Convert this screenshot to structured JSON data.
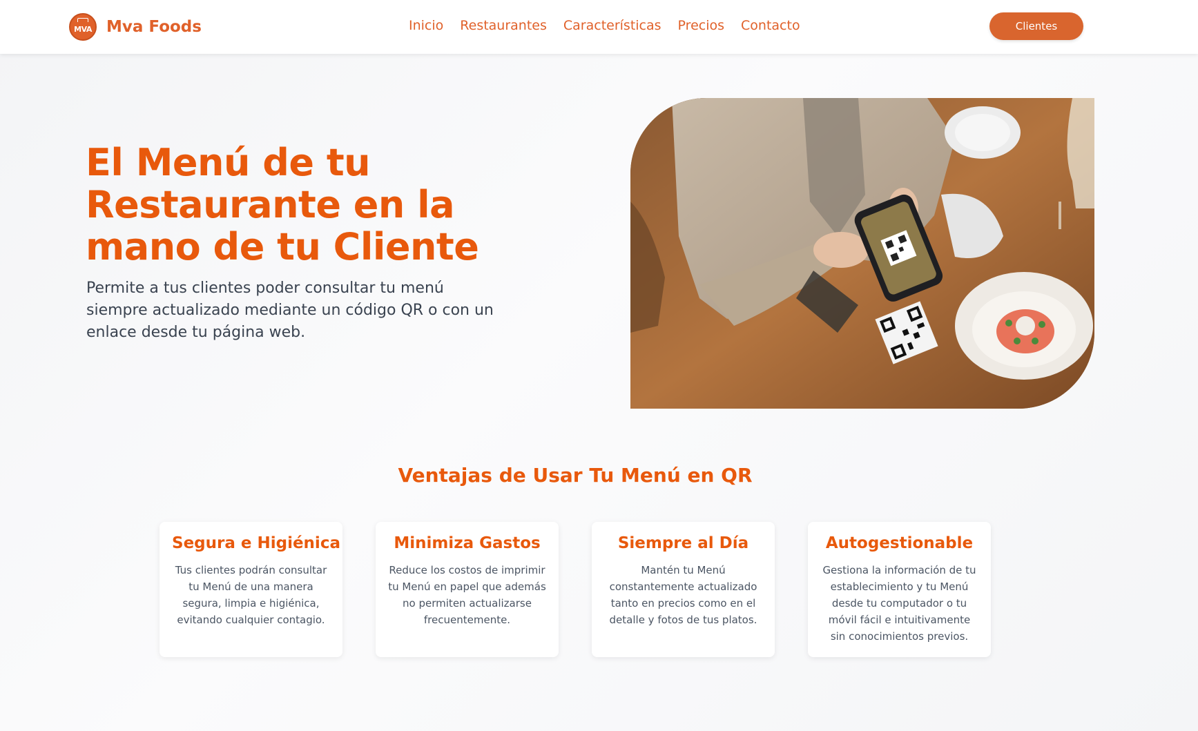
{
  "brand": {
    "logo_text": "MVA",
    "name": "Mva Foods",
    "accent_color": "#e0612a"
  },
  "nav": {
    "links": [
      {
        "label": "Inicio"
      },
      {
        "label": "Restaurantes"
      },
      {
        "label": "Características"
      },
      {
        "label": "Precios"
      },
      {
        "label": "Contacto"
      }
    ],
    "clients_button": "Clientes"
  },
  "hero": {
    "title": "El Menú de tu Restaurante en la mano de tu Cliente",
    "subtitle": "Permite a tus clientes poder consultar tu menú siempre actualizado mediante un código QR o con un enlace desde tu página web."
  },
  "advantages": {
    "title": "Ventajas de Usar Tu Menú en QR",
    "cards": [
      {
        "title": "Segura e Higiénica",
        "text": "Tus clientes podrán consultar tu Menú de una manera segura, limpia e higiénica, evitando cualquier contagio."
      },
      {
        "title": "Minimiza Gastos",
        "text": "Reduce los costos de imprimir tu Menú en papel que además no permiten actualizarse frecuentemente."
      },
      {
        "title": "Siempre al Día",
        "text": "Mantén tu Menú constantemente actualizado tanto en precios como en el detalle y fotos de tus platos."
      },
      {
        "title": "Autogestionable",
        "text": "Gestiona la información de tu establecimiento y tu Menú desde tu computador o tu móvil fácil e intuitivamente sin conocimientos previos."
      }
    ]
  }
}
